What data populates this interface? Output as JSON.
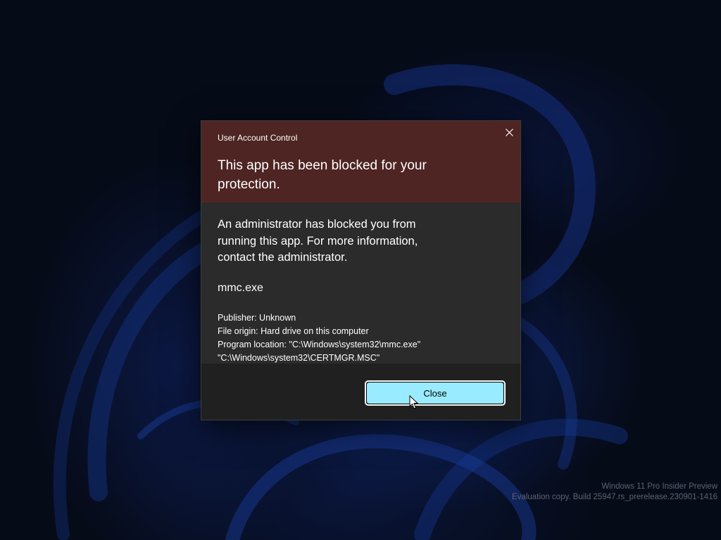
{
  "dialog": {
    "caption": "User Account Control",
    "title": "This app has been blocked for your protection.",
    "message": "An administrator has blocked you from running this app. For more information, contact the administrator.",
    "program_name": "mmc.exe",
    "publisher": "Publisher: Unknown",
    "file_origin": "File origin: Hard drive on this computer",
    "program_location": "Program location: \"C:\\Windows\\system32\\mmc.exe\" \"C:\\Windows\\system32\\CERTMGR.MSC\"",
    "close_button_label": "Close",
    "close_icon": "close-icon",
    "header_color": "#4e2523",
    "button_color": "#99ebff"
  },
  "watermark": {
    "line1": "Windows 11 Pro Insider Preview",
    "line2": "Evaluation copy. Build 25947.rs_prerelease.230901-1416"
  },
  "cursor": {
    "icon": "mouse-pointer-icon"
  }
}
